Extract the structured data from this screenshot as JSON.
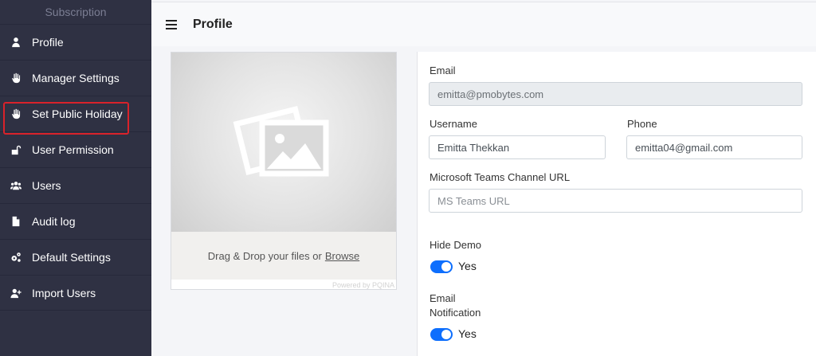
{
  "sidebar": {
    "header": "Subscription",
    "items": [
      {
        "label": "Profile",
        "icon": "user-icon"
      },
      {
        "label": "Manager Settings",
        "icon": "hand-icon"
      },
      {
        "label": "Set Public Holiday",
        "icon": "hand-icon"
      },
      {
        "label": "User Permission",
        "icon": "unlock-icon"
      },
      {
        "label": "Users",
        "icon": "users-icon"
      },
      {
        "label": "Audit log",
        "icon": "file-icon"
      },
      {
        "label": "Default Settings",
        "icon": "gears-icon"
      },
      {
        "label": "Import Users",
        "icon": "user-plus-icon"
      }
    ],
    "highlighted_item": "Set Public Holiday",
    "highlight_color": "#d9222a"
  },
  "header": {
    "title": "Profile"
  },
  "upload": {
    "drop_text": "Drag & Drop your files or",
    "browse_label": "Browse",
    "powered_by": "Powered by PQINA"
  },
  "form": {
    "email": {
      "label": "Email",
      "value": "emitta@pmobytes.com"
    },
    "username": {
      "label": "Username",
      "value": "Emitta Thekkan"
    },
    "phone": {
      "label": "Phone",
      "value": "emitta04@gmail.com"
    },
    "teams": {
      "label": "Microsoft Teams Channel URL",
      "placeholder": "MS Teams URL"
    },
    "hide_demo": {
      "label": "Hide Demo",
      "value": "Yes"
    },
    "email_notification": {
      "label_line1": "Email",
      "label_line2": "Notification",
      "value": "Yes"
    }
  },
  "colors": {
    "sidebar_bg": "#2f3143",
    "toggle_on": "#0d6efd"
  }
}
